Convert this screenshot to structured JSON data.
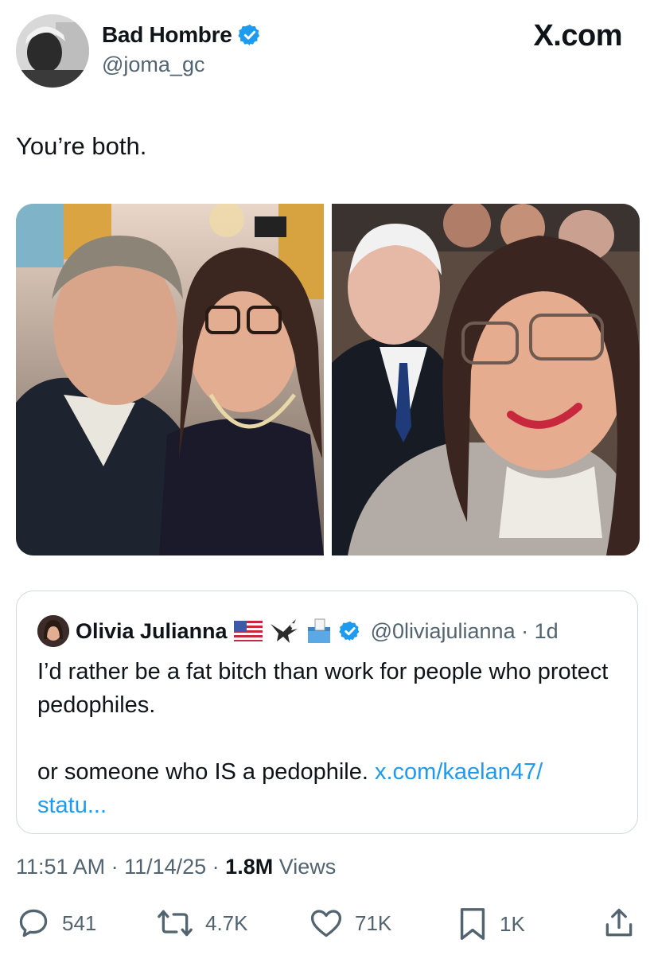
{
  "author": {
    "name": "Bad Hombre",
    "handle": "@joma_gc",
    "verified": true
  },
  "brand": "X.com",
  "tweet": {
    "text": "You’re both."
  },
  "media": [
    {
      "icon": "photo-selfie-left"
    },
    {
      "icon": "photo-selfie-right"
    }
  ],
  "quote": {
    "name": "Olivia Julianna",
    "emojis": [
      "us-flag-icon",
      "eagle-icon",
      "ballot-box-icon"
    ],
    "verified": true,
    "handle_time": "@0liviajulianna · 1d",
    "line1": "I’d rather be a fat bitch than work for people who protect pedophiles.",
    "line2_prefix": "or someone who IS a pedophile. ",
    "link": "x.com/kaelan47/ statu..."
  },
  "meta": {
    "time_date": "11:51 AM · 11/14/25 · ",
    "views_count": "1.8M",
    "views_label": " Views"
  },
  "actions": {
    "replies": "541",
    "reposts": "4.7K",
    "likes": "71K",
    "bookmarks": "1K"
  },
  "colors": {
    "accent": "#1d9bf0",
    "text": "#0f1419",
    "secondary": "#536471",
    "border": "#cfd9de"
  }
}
